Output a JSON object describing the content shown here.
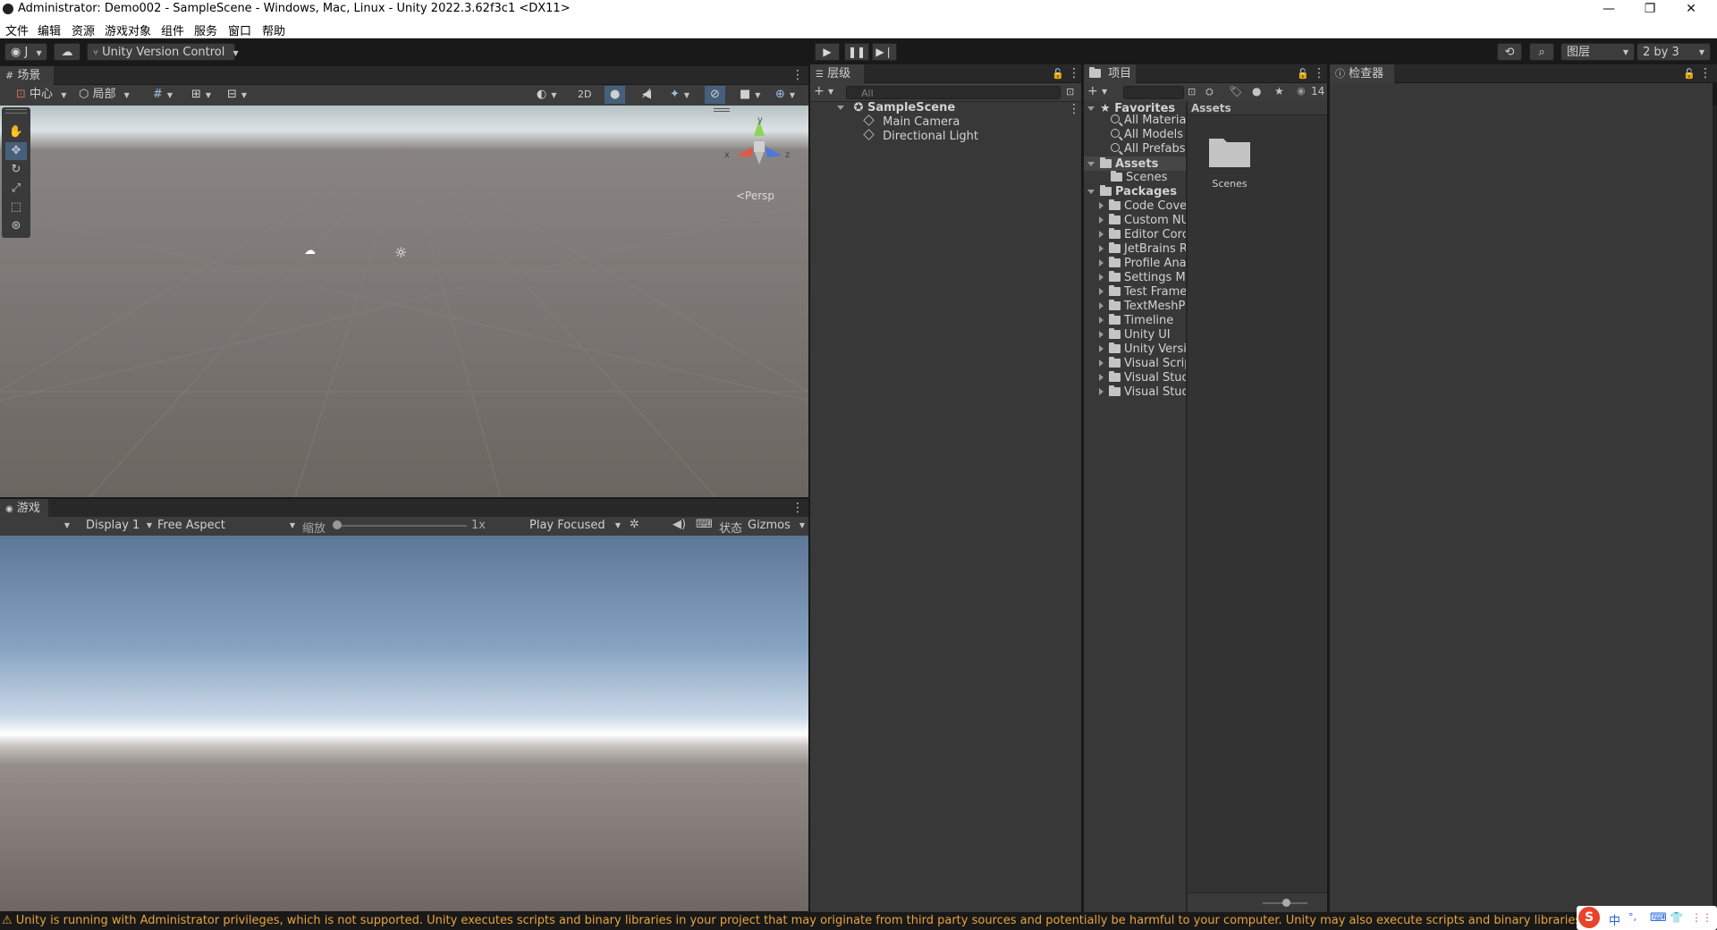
{
  "window": {
    "title": "Administrator: Demo002 - SampleScene - Windows, Mac, Linux - Unity 2022.3.62f3c1 <DX11>",
    "min": "—",
    "max": "❐",
    "close": "✕"
  },
  "menu": [
    "文件",
    "编辑",
    "资源",
    "游戏对象",
    "组件",
    "服务",
    "窗口",
    "帮助"
  ],
  "toolbar": {
    "account": "J",
    "version_control": "Unity Version Control",
    "layers": "图层",
    "layout": "2 by 3"
  },
  "scene": {
    "tab": "场景",
    "pivot": "中心",
    "space": "局部",
    "mode_2d": "2D",
    "persp": "<Persp",
    "axes": {
      "y": "y",
      "x": "x",
      "z": "z"
    }
  },
  "game": {
    "tab": "游戏",
    "display": "Display 1",
    "aspect": "Free Aspect",
    "scale_label": "缩放",
    "scale_value": "1x",
    "scale_fraction": 0.0,
    "play_mode": "Play Focused",
    "stats": "状态",
    "gizmos": "Gizmos"
  },
  "hierarchy": {
    "tab": "层级",
    "search_placeholder": "All",
    "scene": "SampleScene",
    "items": [
      "Main Camera",
      "Directional Light"
    ]
  },
  "project": {
    "tab": "项目",
    "hidden_count": "14",
    "favorites_label": "Favorites",
    "favorites": [
      "All Material",
      "All Models",
      "All Prefabs"
    ],
    "assets_label": "Assets",
    "assets_children": [
      "Scenes"
    ],
    "packages_label": "Packages",
    "packages": [
      "Code Cover",
      "Custom NU",
      "Editor Corc",
      "JetBrains Ri",
      "Profile Anal",
      "Settings Ma",
      "Test Frame\\",
      "TextMeshPr",
      "Timeline",
      "Unity UI",
      "Unity Versic",
      "Visual Scrip",
      "Visual Studi",
      "Visual Studi"
    ],
    "grid_header": "Assets",
    "grid_items": [
      "Scenes"
    ]
  },
  "inspector": {
    "tab": "检查器"
  },
  "status_bar": {
    "message": "Unity is running with Administrator privileges, which is not supported. Unity executes scripts and binary libraries in your project that may originate from third party sources and potentially be harmful to your computer. Unity may also execute scripts and binary libraries that are still under development"
  },
  "taskbar_ime": [
    "中",
    "°,",
    "⌨",
    "👕",
    "⋮⋮"
  ],
  "colors": {
    "warning": "#e8a23a",
    "selection": "#46607c",
    "panel": "#383838",
    "background": "#191919"
  }
}
